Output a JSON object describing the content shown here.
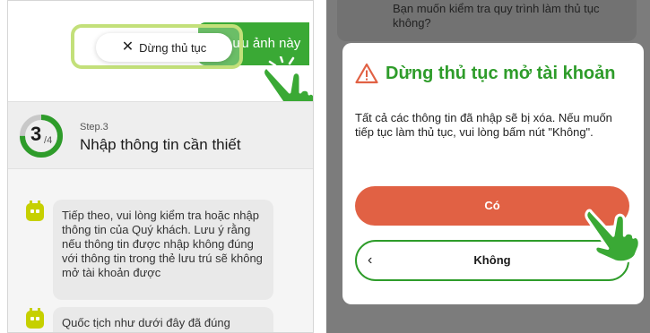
{
  "left_screen": {
    "save_button_label": "Lưu ảnh này",
    "stop_button_label": "Dừng thủ tục",
    "step": {
      "current": "3",
      "total": "4",
      "progress": 0.75,
      "small_label": "Step.3",
      "title": "Nhập thông tin cần thiết"
    },
    "messages": [
      "Tiếp theo, vui lòng kiểm tra hoặc nhập thông tin của Quý khách. Lưu ý rằng nếu thông tin được nhập không đúng với thông tin trong thẻ lưu trú sẽ không mở tài khoản được",
      "Quốc tịch như dưới đây đã đúng"
    ]
  },
  "right_screen": {
    "behind_message": "Bạn muốn kiểm tra quy trình làm thủ tục không?",
    "modal": {
      "title": "Dừng thủ tục mở tài khoản",
      "message": "Tất cả các thông tin đã nhập sẽ bị xóa. Nếu muốn tiếp tục làm thủ tục, vui lòng bấm nút \"Không\".",
      "yes_label": "Có",
      "no_label": "Không",
      "no_chevron": "‹"
    }
  },
  "colors": {
    "brand_green": "#3aa935",
    "title_green": "#2e9c2a",
    "danger_orange": "#e16144",
    "highlight_lime": "#c3e07a",
    "bot_yellow": "#c6d000",
    "overlay_gray": "#7c7c7c"
  },
  "icons": {
    "stop": "close-icon",
    "warning": "warning-triangle-icon",
    "bot": "chatbot-icon",
    "pointer": "hand-pointer-icon",
    "back": "chevron-left-icon"
  }
}
